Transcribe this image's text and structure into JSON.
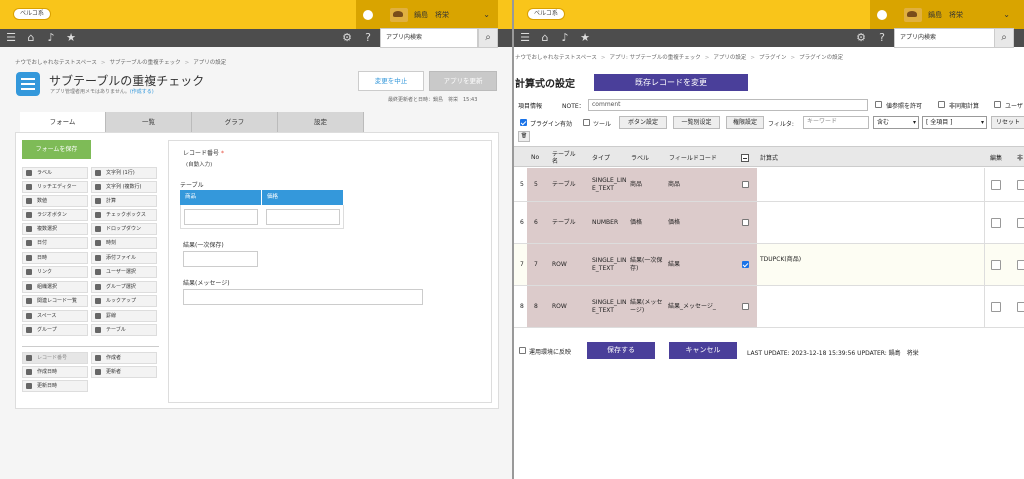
{
  "left": {
    "logo": "ベルコ系",
    "user": "鍋島　将栄",
    "search_placeholder": "アプリ内検索",
    "breadcrumb": [
      "ナウでおしゃれなテストスペース",
      "サブテーブルの重複チェック",
      "アプリの設定"
    ],
    "app_title": "サブテーブルの重複チェック",
    "app_desc": "アプリ管理者用メモはありません。",
    "app_desc_link": "(作成する)",
    "btn_cancel": "変更を中止",
    "btn_update": "アプリを更新",
    "last_updated": "最終更新者と日時：鍋島　将栄　15:43",
    "tabs": [
      "フォーム",
      "一覧",
      "グラフ",
      "設定"
    ],
    "save_form": "フォームを保存",
    "palette": [
      [
        "ラベル",
        "文字列 (1行)"
      ],
      [
        "リッチエディター",
        "文字列 (複数行)"
      ],
      [
        "数値",
        "計算"
      ],
      [
        "ラジオボタン",
        "チェックボックス"
      ],
      [
        "複数選択",
        "ドロップダウン"
      ],
      [
        "日付",
        "時刻"
      ],
      [
        "日時",
        "添付ファイル"
      ],
      [
        "リンク",
        "ユーザー選択"
      ],
      [
        "組織選択",
        "グループ選択"
      ],
      [
        "関連レコード一覧",
        "ルックアップ"
      ],
      [
        "スペース",
        "罫線"
      ],
      [
        "グループ",
        "テーブル"
      ]
    ],
    "palette_sys": [
      [
        "レコード番号",
        "作成者"
      ],
      [
        "作成日時",
        "更新者"
      ],
      [
        "更新日時",
        ""
      ]
    ],
    "form": {
      "record_no_label": "レコード番号",
      "record_no_required": "*",
      "record_no_note": "(自動入力)",
      "table_label": "テーブル",
      "col1": "商品",
      "col2": "価格",
      "result1_label": "結果(一次保存)",
      "result2_label": "結果(メッセージ)"
    }
  },
  "right": {
    "logo": "ベルコ系",
    "user": "鍋島　将栄",
    "search_placeholder": "アプリ内検索",
    "breadcrumb": [
      "ナウでおしゃれなテストスペース",
      "アプリ: サブテーブルの重複チェック",
      "アプリの設定",
      "プラグイン",
      "プラグインの設定"
    ],
    "title": "計算式の設定",
    "btn_change": "既存レコードを変更",
    "item_info": "項目情報",
    "note_label": "NOTE：",
    "note_value": "comment",
    "cb_value_ref": "値参照を許可",
    "cb_async": "非同期計算",
    "cb_user": "ユーザ",
    "cb_plugin": "プラグイン有効",
    "cb_tool": "ツール",
    "btn_button_setting": "ボタン設定",
    "btn_list_setting": "一覧别设定",
    "btn_perm_setting": "権限設定",
    "filter_label": "フィルタ:",
    "keyword_placeholder": "キーワード",
    "sel_contains": "含む",
    "sel_all": "[ 全項目 ]",
    "btn_reset": "リセット",
    "trash_icon_label": "🗑",
    "headers": {
      "no": "No",
      "table": "テーブル名",
      "type": "タイプ",
      "label": "ラベル",
      "code": "フィールドコード",
      "formula": "計算式",
      "edit": "編集",
      "other": "非"
    },
    "rows": [
      {
        "idx": "5",
        "no": "5",
        "table": "テーブル",
        "type": "SINGLE_LINE_TEXT",
        "label": "商品",
        "code": "商品",
        "checked": false,
        "formula": ""
      },
      {
        "idx": "6",
        "no": "6",
        "table": "テーブル",
        "type": "NUMBER",
        "label": "価格",
        "code": "価格",
        "checked": false,
        "formula": ""
      },
      {
        "idx": "7",
        "no": "7",
        "table": "ROW",
        "type": "SINGLE_LINE_TEXT",
        "label": "結果(一次保存)",
        "code": "結果",
        "checked": true,
        "formula": "TDUPCK(商品)"
      },
      {
        "idx": "8",
        "no": "8",
        "table": "ROW",
        "type": "SINGLE_LINE_TEXT",
        "label": "結果(メッセージ)",
        "code": "結果_メッセージ_",
        "checked": false,
        "formula": ""
      }
    ],
    "cb_apply_env": "運用環境に反映",
    "btn_save": "保存する",
    "btn_cancel": "キャンセル",
    "last_update": "LAST UPDATE: 2023-12-18 15:39:56 UPDATER: 鍋島　将栄",
    "colors": {
      "topbar": "#f9c51a",
      "navbar": "#4d4d4d",
      "primary": "#4a3f9a",
      "accent_blue": "#3498db",
      "save_green": "#7ebb57"
    }
  }
}
